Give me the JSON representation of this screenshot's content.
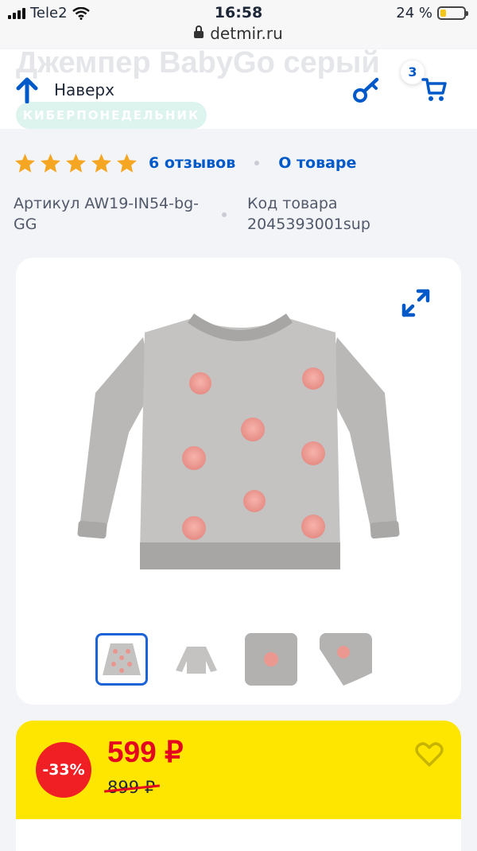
{
  "status_bar": {
    "carrier": "Tele2",
    "time": "16:58",
    "battery": "24 %",
    "battery_level": 0.24
  },
  "browser": {
    "url": "detmir.ru"
  },
  "header": {
    "faded_title": "Джемпер BabyGo серый",
    "faded_badge": "КИБЕРПОНЕДЕЛЬНИК",
    "up_label": "Наверх",
    "cart_count": "3"
  },
  "product": {
    "rating": 5,
    "reviews_link": "6 отзывов",
    "about_link": "О товаре",
    "article": "Артикул AW19-IN54-bg-GG",
    "code": "Код товара 2045393001sup"
  },
  "gallery": {
    "thumb_count": 4,
    "active_thumb": 0
  },
  "price": {
    "discount": "-33%",
    "current": "599 ₽",
    "old": "899 ₽"
  },
  "colors": {
    "accent": "#0059c8",
    "price_red": "#e3061e",
    "yellow": "#ffe600",
    "star": "#f5a623"
  }
}
